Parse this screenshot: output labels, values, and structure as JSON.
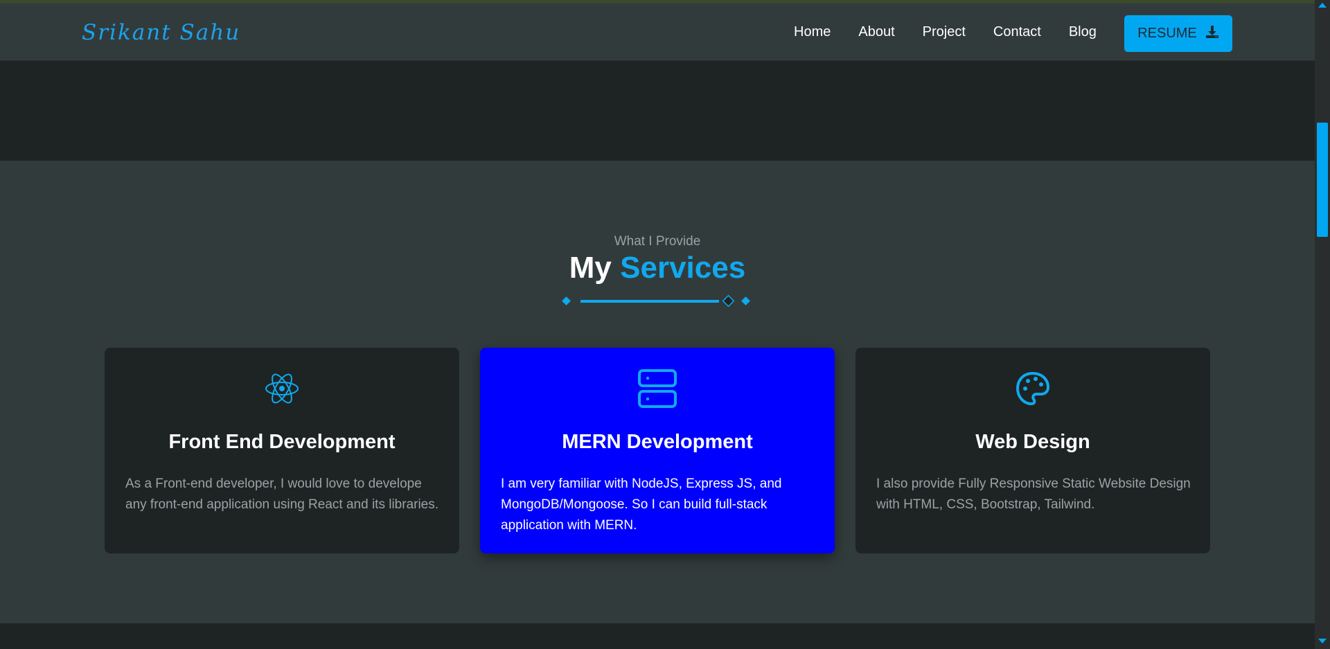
{
  "brand": {
    "name": "Srikant Sahu",
    "accent_color": "#10a9ef",
    "button_color": "#02a7f2"
  },
  "nav": {
    "items": [
      {
        "label": "Home"
      },
      {
        "label": "About"
      },
      {
        "label": "Project"
      },
      {
        "label": "Contact"
      },
      {
        "label": "Blog"
      }
    ],
    "resume_label": "RESUME",
    "resume_icon": "download-icon"
  },
  "services": {
    "subtitle": "What I Provide",
    "title_main": "My",
    "title_accent": "Services",
    "cards": [
      {
        "icon": "atom-icon",
        "title": "Front End Development",
        "description": "As a Front-end developer, I would love to develope any front-end application using React and its libraries.",
        "highlighted": false
      },
      {
        "icon": "server-icon",
        "title": "MERN Development",
        "description": "I am very familiar with NodeJS, Express JS, and MongoDB/Mongoose. So I can build full-stack application with MERN.",
        "highlighted": true,
        "highlight_color": "#0000ff"
      },
      {
        "icon": "palette-icon",
        "title": "Web Design",
        "description": "I also provide Fully Responsive Static Website Design with HTML, CSS, Bootstrap, Tailwind.",
        "highlighted": false
      }
    ]
  }
}
